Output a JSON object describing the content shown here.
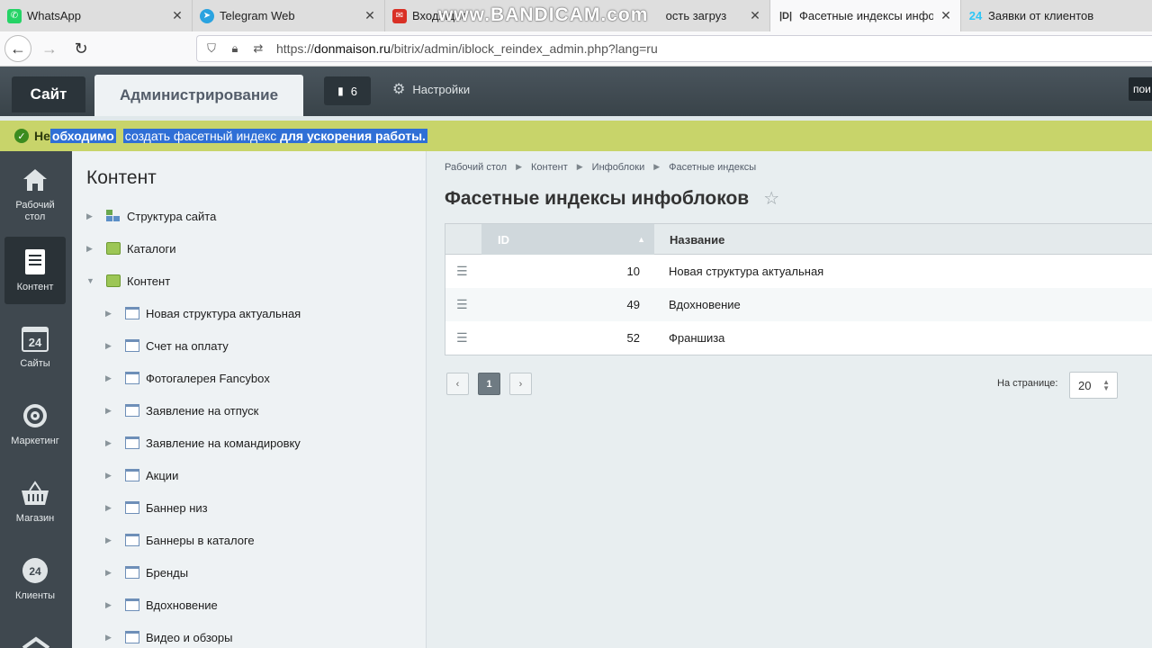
{
  "browser": {
    "tabs": [
      {
        "label": "WhatsApp",
        "icon": "whatsapp-icon",
        "color": "#25d366"
      },
      {
        "label": "Telegram Web",
        "icon": "telegram-icon",
        "color": "#2aa3e0"
      },
      {
        "label": "Входящие",
        "icon": "mail-icon",
        "color": "#d93025",
        "tail": "ость загруз"
      },
      {
        "label": "Фасетные индексы инфобл",
        "icon": "bitrix-icon",
        "color": "#333333"
      },
      {
        "label": "Заявки от клиентов",
        "icon": "bitrix24-icon",
        "color": "#2fc6f6"
      }
    ],
    "watermark": "www.BANDICAM.com",
    "url_prefix": "https://",
    "url_domain": "donmaison.ru",
    "url_path": "/bitrix/admin/iblock_reindex_admin.php?lang=ru"
  },
  "header": {
    "site_label": "Сайт",
    "admin_label": "Администрирование",
    "notifications_count": "6",
    "settings_label": "Настройки",
    "search_text": "пои"
  },
  "notice": {
    "part1": "Не",
    "part1_selected": "обходимо",
    "part2": "создать фасетный индекс",
    "part2_bold": "для ускорения работы."
  },
  "iconbar": [
    {
      "label": "Рабочий стол",
      "icon": "home-icon"
    },
    {
      "label": "Контент",
      "icon": "content-icon"
    },
    {
      "label": "Сайты",
      "icon": "sites-icon"
    },
    {
      "label": "Маркетинг",
      "icon": "target-icon"
    },
    {
      "label": "Магазин",
      "icon": "basket-icon"
    },
    {
      "label": "Клиенты",
      "icon": "clients-icon"
    }
  ],
  "menu": {
    "title": "Контент",
    "items": [
      {
        "label": "Структура сайта",
        "level": 0,
        "expanded": false,
        "icon": "structure-icon"
      },
      {
        "label": "Каталоги",
        "level": 0,
        "expanded": false,
        "icon": "catalog-icon"
      },
      {
        "label": "Контент",
        "level": 0,
        "expanded": true,
        "icon": "catalog-icon"
      },
      {
        "label": "Новая структура актуальная",
        "level": 1,
        "expanded": false,
        "icon": "iblock-icon"
      },
      {
        "label": "Счет на оплату",
        "level": 1,
        "expanded": false,
        "icon": "iblock-icon"
      },
      {
        "label": "Фотогалерея Fancybox",
        "level": 1,
        "expanded": false,
        "icon": "iblock-icon"
      },
      {
        "label": "Заявление на отпуск",
        "level": 1,
        "expanded": false,
        "icon": "iblock-icon"
      },
      {
        "label": "Заявление на командировку",
        "level": 1,
        "expanded": false,
        "icon": "iblock-icon"
      },
      {
        "label": "Акции",
        "level": 1,
        "expanded": false,
        "icon": "iblock-icon"
      },
      {
        "label": "Баннер низ",
        "level": 1,
        "expanded": false,
        "icon": "iblock-icon"
      },
      {
        "label": "Баннеры в каталоге",
        "level": 1,
        "expanded": false,
        "icon": "iblock-icon"
      },
      {
        "label": "Бренды",
        "level": 1,
        "expanded": false,
        "icon": "iblock-icon"
      },
      {
        "label": "Вдохновение",
        "level": 1,
        "expanded": false,
        "icon": "iblock-icon"
      },
      {
        "label": "Видео и обзоры",
        "level": 1,
        "expanded": false,
        "icon": "iblock-icon"
      }
    ]
  },
  "breadcrumbs": [
    "Рабочий стол",
    "Контент",
    "Инфоблоки",
    "Фасетные индексы"
  ],
  "page_title": "Фасетные индексы инфоблоков",
  "grid": {
    "columns": [
      "ID",
      "Название"
    ],
    "rows": [
      {
        "id": "10",
        "name": "Новая структура актуальная"
      },
      {
        "id": "49",
        "name": "Вдохновение"
      },
      {
        "id": "52",
        "name": "Франшиза"
      }
    ]
  },
  "pager": {
    "prev": "‹",
    "current": "1",
    "next": "›",
    "per_page_label": "На странице:",
    "per_page_value": "20"
  },
  "colors": {
    "header_bg": "#3f4a52",
    "notice_bg": "#c8d46a",
    "selection": "#2f6fd6",
    "accent_ok": "#3c8c1f"
  }
}
